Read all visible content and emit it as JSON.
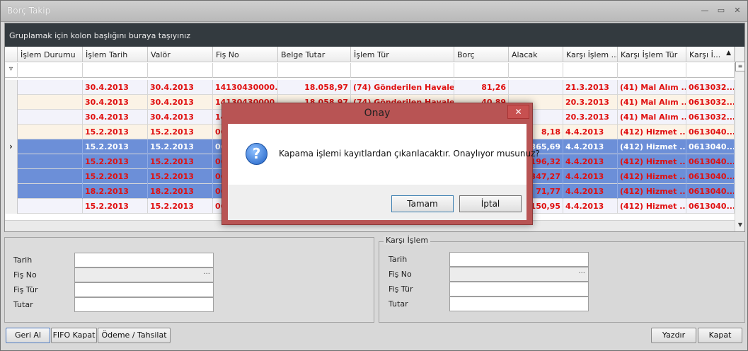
{
  "window": {
    "title": "Borç Takip"
  },
  "grid": {
    "group_hint": "Gruplamak için kolon başlığını buraya taşıyınız",
    "columns": [
      "İşlem Durumu",
      "İşlem Tarih",
      "Valör",
      "Fiş No",
      "Belge Tutar",
      "İşlem Tür",
      "Borç",
      "Alacak",
      "Karşı İşlem ...",
      "Karşı İşlem Tür",
      "Karşı İ..."
    ],
    "rows": [
      {
        "durum": "",
        "tarih": "30.4.2013",
        "valor": "30.4.2013",
        "fis": "14130430000...",
        "tutar": "18.058,97",
        "tur": "(74) Gönderilen Havale...",
        "borc": "81,26",
        "alacak": "",
        "k_tarih": "21.3.2013",
        "k_tur": "(41) Mal Alım ...",
        "k_no": "0613032..."
      },
      {
        "durum": "",
        "tarih": "30.4.2013",
        "valor": "30.4.2013",
        "fis": "14130430000...",
        "tutar": "18.058,97",
        "tur": "(74) Gönderilen Havale...",
        "borc": "40,89",
        "alacak": "",
        "k_tarih": "20.3.2013",
        "k_tur": "(41) Mal Alım ...",
        "k_no": "0613032..."
      },
      {
        "durum": "",
        "tarih": "30.4.2013",
        "valor": "30.4.2013",
        "fis": "14",
        "tutar": "",
        "tur": "",
        "borc": "",
        "alacak": "",
        "k_tarih": "20.3.2013",
        "k_tur": "(41) Mal Alım ...",
        "k_no": "0613032..."
      },
      {
        "durum": "",
        "tarih": "15.2.2013",
        "valor": "15.2.2013",
        "fis": "06",
        "tutar": "",
        "tur": "",
        "borc": "",
        "alacak": "8,18",
        "k_tarih": "4.4.2013",
        "k_tur": "(412) Hizmet ...",
        "k_no": "0613040..."
      },
      {
        "durum": "",
        "tarih": "15.2.2013",
        "valor": "15.2.2013",
        "fis": "06",
        "tutar": "",
        "tur": "",
        "borc": "",
        "alacak": "365,69",
        "k_tarih": "4.4.2013",
        "k_tur": "(412) Hizmet ...",
        "k_no": "0613040..."
      },
      {
        "durum": "",
        "tarih": "15.2.2013",
        "valor": "15.2.2013",
        "fis": "06",
        "tutar": "",
        "tur": "",
        "borc": "",
        "alacak": "196,32",
        "k_tarih": "4.4.2013",
        "k_tur": "(412) Hizmet ...",
        "k_no": "0613040..."
      },
      {
        "durum": "",
        "tarih": "15.2.2013",
        "valor": "15.2.2013",
        "fis": "06",
        "tutar": "",
        "tur": "",
        "borc": "",
        "alacak": "347,27",
        "k_tarih": "4.4.2013",
        "k_tur": "(412) Hizmet ...",
        "k_no": "0613040..."
      },
      {
        "durum": "",
        "tarih": "18.2.2013",
        "valor": "18.2.2013",
        "fis": "06",
        "tutar": "",
        "tur": "",
        "borc": "",
        "alacak": "71,77",
        "k_tarih": "4.4.2013",
        "k_tur": "(412) Hizmet ...",
        "k_no": "0613040..."
      },
      {
        "durum": "",
        "tarih": "15.2.2013",
        "valor": "15.2.2013",
        "fis": "06",
        "tutar": "",
        "tur": "",
        "borc": "",
        "alacak": "150,95",
        "k_tarih": "4.4.2013",
        "k_tur": "(412) Hizmet ...",
        "k_no": "0613040..."
      }
    ]
  },
  "detail": {
    "left": {
      "tarih": "Tarih",
      "fis_no": "Fiş No",
      "fis_tur": "Fiş Tür",
      "tutar": "Tutar",
      "dots": "···"
    },
    "right": {
      "legend": "Karşı İşlem",
      "tarih": "Tarih",
      "fis_no": "Fiş No",
      "fis_tur": "Fiş Tür",
      "tutar": "Tutar",
      "dots": "···"
    }
  },
  "buttons": {
    "geri_al": "Geri Al",
    "fifo": "FIFO Kapat",
    "odeme": "Ödeme / Tahsilat",
    "yazdir": "Yazdır",
    "kapat": "Kapat"
  },
  "dialog": {
    "title": "Onay",
    "close": "✕",
    "icon": "?",
    "message": "Kapama işlemi kayıtlardan çıkarılacaktır. Onaylıyor musunuz?",
    "ok": "Tamam",
    "cancel": "İptal"
  }
}
